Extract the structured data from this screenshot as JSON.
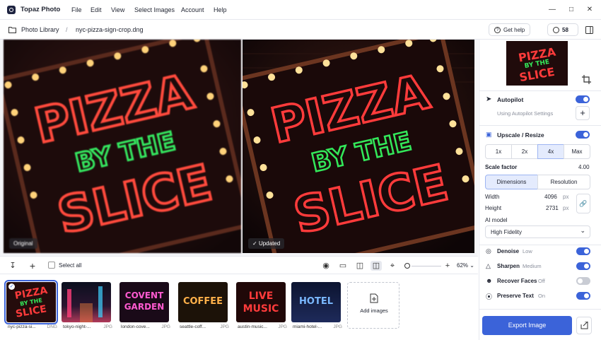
{
  "app": {
    "name": "Topaz Photo",
    "menu": [
      "File",
      "Edit",
      "View",
      "Select Images",
      "Account",
      "Help"
    ]
  },
  "breadcrumb": {
    "root": "Photo Library",
    "separator": "/",
    "file": "nyc-pizza-sign-crop.dng"
  },
  "header": {
    "get_help": "Get help",
    "credits": "58"
  },
  "viewer": {
    "left_tag": "Original",
    "right_tag": "Updated"
  },
  "toolbar": {
    "select_all": "Select all",
    "zoom": "62%"
  },
  "filmstrip": {
    "items": [
      {
        "name": "nyc-pizza-si...",
        "ext": "DNG"
      },
      {
        "name": "tokyo-night-...",
        "ext": "JPG"
      },
      {
        "name": "london-cove...",
        "ext": "JPG"
      },
      {
        "name": "seattle-coff...",
        "ext": "JPG"
      },
      {
        "name": "austin-music...",
        "ext": "JPG"
      },
      {
        "name": "miami-hotel-...",
        "ext": "JPG"
      }
    ],
    "add_images": "Add images"
  },
  "panel": {
    "autopilot": {
      "label": "Autopilot",
      "sub": "Using Autopilot Settings",
      "enabled": true
    },
    "upscale": {
      "label": "Upscale / Resize",
      "enabled": true,
      "scales": [
        "1x",
        "2x",
        "4x",
        "Max"
      ],
      "selected_scale": "4x",
      "scale_factor_label": "Scale factor",
      "scale_factor": "4.00",
      "modes": [
        "Dimensions",
        "Resolution"
      ],
      "selected_mode": "Dimensions",
      "width_label": "Width",
      "width": "4096",
      "height_label": "Height",
      "height": "2731",
      "unit": "px",
      "ai_model_label": "AI model",
      "ai_model": "High Fidelity"
    },
    "filters": [
      {
        "label": "Denoise",
        "level": "Low",
        "enabled": true
      },
      {
        "label": "Sharpen",
        "level": "Medium",
        "enabled": true
      },
      {
        "label": "Recover Faces",
        "level": "Off",
        "enabled": false
      },
      {
        "label": "Preserve Text",
        "level": "On",
        "enabled": true
      }
    ],
    "export": "Export Image"
  },
  "colors": {
    "accent": "#3b63d9",
    "neon_red": "#ff3b3b",
    "neon_green": "#33e85a"
  }
}
